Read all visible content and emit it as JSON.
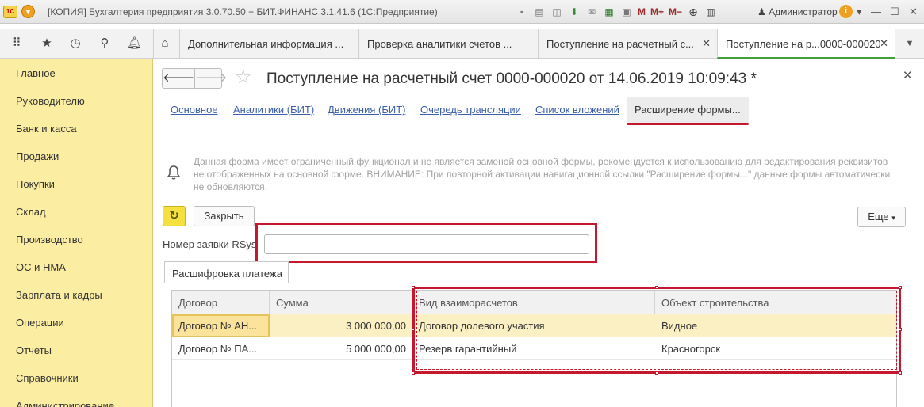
{
  "titlebar": {
    "logo": "1С",
    "title": "[КОПИЯ] Бухгалтерия предприятия 3.0.70.50 + БИТ.ФИНАНС 3.1.41.6  (1С:Предприятие)",
    "m_buttons": [
      "M",
      "M+",
      "M−"
    ],
    "user": "Администратор"
  },
  "tabs": [
    {
      "label": "Дополнительная информация ..."
    },
    {
      "label": "Проверка аналитики счетов ..."
    },
    {
      "label": "Поступление на расчетный с..."
    },
    {
      "label": "Поступление на р...0000-000020",
      "active": true
    }
  ],
  "sidebar": {
    "items": [
      {
        "label": "Главное"
      },
      {
        "label": "Руководителю"
      },
      {
        "label": "Банк и касса"
      },
      {
        "label": "Продажи"
      },
      {
        "label": "Покупки"
      },
      {
        "label": "Склад"
      },
      {
        "label": "Производство"
      },
      {
        "label": "ОС и НМА"
      },
      {
        "label": "Зарплата и кадры"
      },
      {
        "label": "Операции"
      },
      {
        "label": "Отчеты"
      },
      {
        "label": "Справочники"
      },
      {
        "label": "Администрирование"
      }
    ]
  },
  "form": {
    "title": "Поступление на расчетный счет 0000-000020 от 14.06.2019 10:09:43 *",
    "links": [
      {
        "label": "Основное"
      },
      {
        "label": "Аналитики (БИТ)"
      },
      {
        "label": "Движения (БИТ)"
      },
      {
        "label": "Очередь трансляции"
      },
      {
        "label": "Список вложений"
      },
      {
        "label": "Расширение формы...",
        "current": true
      }
    ],
    "notice": "Данная форма имеет ограниченный функционал и не является заменой основной формы, рекомендуется к использованию для редактирования реквизитов не отображенных на основной форме. ВНИМАНИЕ: При повторной активации навигационной ссылки \"Расширение формы...\" данные формы автоматически не обновляются.",
    "close_label": "Закрыть",
    "more_label": "Еще",
    "field_label": "Номер заявки RSys",
    "field_value": "",
    "group_tab": "Расшифровка платежа"
  },
  "table": {
    "columns": [
      "Договор",
      "Сумма",
      "Вид взаиморасчетов",
      "Объект строительства"
    ],
    "rows": [
      {
        "contract": "Договор № АН...",
        "sum": "3 000 000,00",
        "type": "Договор долевого участия",
        "object": "Видное",
        "selected": true
      },
      {
        "contract": "Договор № ПА...",
        "sum": "5 000 000,00",
        "type": "Резерв гарантийный",
        "object": "Красногорск",
        "selected": false
      }
    ]
  },
  "colors": {
    "sidebar_bg": "#fbeea3",
    "accent_red": "#c5182d",
    "link_blue": "#3b5fa8",
    "active_tab_green": "#3f9f3f",
    "selected_row": "#fbf0c4"
  }
}
